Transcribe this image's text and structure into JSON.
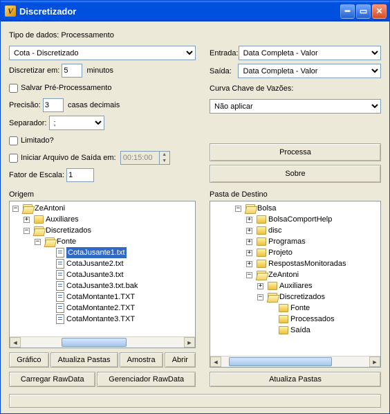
{
  "window": {
    "title": "Discretizador"
  },
  "left": {
    "tipo_dados_label": "Tipo de dados: Processamento",
    "tipo_dados_value": "Cota - Discretizado",
    "discretizar_label": "Discretizar em:",
    "discretizar_value": "5",
    "discretizar_unit": "minutos",
    "salvar_pre_label": "Salvar Pré-Processamento",
    "precisao_label": "Precisão:",
    "precisao_value": "3",
    "precisao_unit": "casas decimais",
    "separador_label": "Separador:",
    "separador_value": ";",
    "limitado_label": "Limitado?",
    "iniciar_label": "Iniciar Arquivo de Saída em:",
    "iniciar_value": "00:15:00",
    "fator_label": "Fator de Escala:",
    "fator_value": "1"
  },
  "right": {
    "entrada_label": "Entrada:",
    "entrada_value": "Data Completa - Valor",
    "saida_label": "Saída:",
    "saida_value": "Data Completa - Valor",
    "curva_label": "Curva Chave de Vazões:",
    "curva_value": "Não aplicar",
    "btn_processa": "Processa",
    "btn_sobre": "Sobre"
  },
  "origem": {
    "title": "Origem",
    "root": "ZeAntoni",
    "aux": "Auxiliares",
    "disc": "Discretizados",
    "fonte": "Fonte",
    "files": [
      "CotaJusante1.txt",
      "CotaJusante2.txt",
      "CotaJusante3.txt",
      "CotaJusante3.txt.bak",
      "CotaMontante1.TXT",
      "CotaMontante2.TXT",
      "CotaMontante3.TXT"
    ],
    "selected_index": 0,
    "btn_grafico": "Gráfico",
    "btn_atualiza": "Atualiza Pastas",
    "btn_amostra": "Amostra",
    "btn_abrir": "Abrir",
    "btn_carregar": "Carregar RawData",
    "btn_gerenciador": "Gerenciador RawData"
  },
  "destino": {
    "title": "Pasta de Destino",
    "nodes": {
      "bolsa": "Bolsa",
      "bolsaComport": "BolsaComportHelp",
      "disc": "disc",
      "programas": "Programas",
      "projeto": "Projeto",
      "respostas": "RespostasMonitoradas",
      "zeantoni": "ZeAntoni",
      "aux": "Auxiliares",
      "discretizados": "Discretizados",
      "fonte": "Fonte",
      "processados": "Processados",
      "saida": "Saída"
    },
    "btn_atualiza": "Atualiza Pastas"
  }
}
